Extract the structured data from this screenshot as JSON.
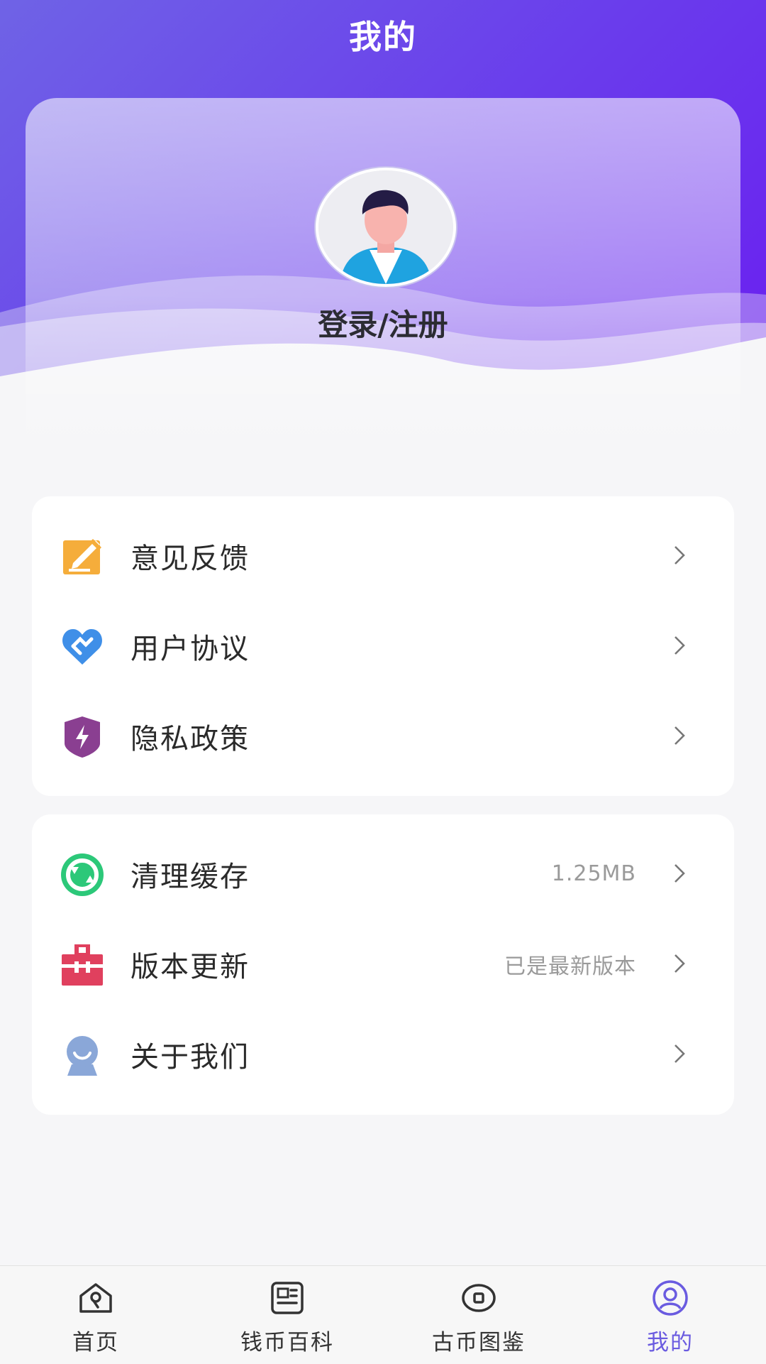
{
  "header": {
    "title": "我的"
  },
  "profile": {
    "login_label": "登录/注册",
    "avatar_icon": "user-avatar"
  },
  "menu_group_1": [
    {
      "label": "意见反馈",
      "icon": "feedback-edit-icon"
    },
    {
      "label": "用户协议",
      "icon": "agreement-heart-icon"
    },
    {
      "label": "隐私政策",
      "icon": "privacy-shield-icon"
    }
  ],
  "menu_group_2": [
    {
      "label": "清理缓存",
      "value": "1.25MB",
      "icon": "clear-cache-icon"
    },
    {
      "label": "版本更新",
      "value": "已是最新版本",
      "icon": "version-update-icon"
    },
    {
      "label": "关于我们",
      "icon": "about-us-icon"
    }
  ],
  "tabbar": {
    "tabs": [
      {
        "label": "首页",
        "icon": "home-icon"
      },
      {
        "label": "钱币百科",
        "icon": "encyclopedia-icon"
      },
      {
        "label": "古币图鉴",
        "icon": "coin-catalog-icon"
      },
      {
        "label": "我的",
        "icon": "profile-icon",
        "active": true
      }
    ]
  },
  "colors": {
    "accent": "#6a5be0",
    "header_start": "#6f63e6",
    "header_end": "#6a1ff0",
    "feedback": "#f5ad3b",
    "agreement": "#3f8fe8",
    "privacy": "#8a3f91",
    "cache": "#2cc879",
    "update": "#e0405e",
    "about": "#8aa7d8"
  }
}
